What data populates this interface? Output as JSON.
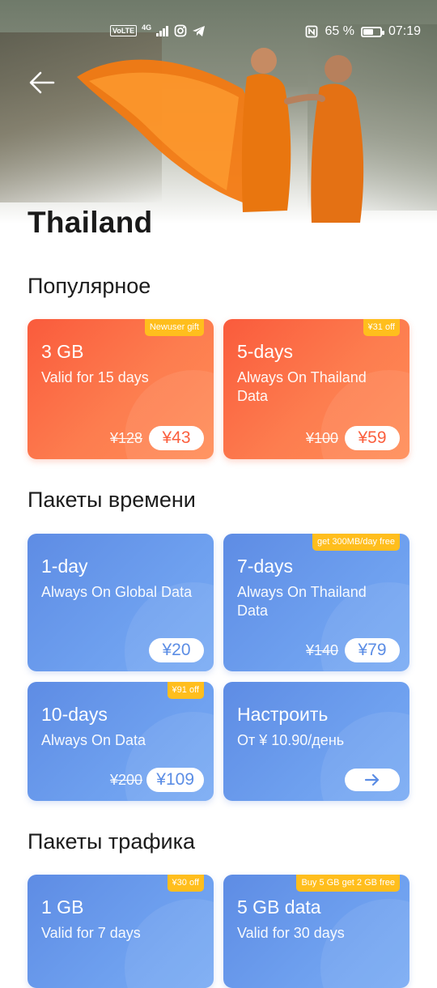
{
  "status_bar": {
    "volte": "VoLTE",
    "network": "4G",
    "battery_percent": "65 %",
    "battery_level": 0.65,
    "time": "07:19"
  },
  "page": {
    "title": "Thailand"
  },
  "sections": {
    "popular": {
      "title": "Популярное",
      "cards": [
        {
          "badge": "Newuser gift",
          "title": "3 GB",
          "subtitle": "Valid for 15 days",
          "old_price": "¥128",
          "price": "¥43",
          "theme": "orange"
        },
        {
          "badge": "¥31 off",
          "title": "5-days",
          "subtitle": "Always On Thailand Data",
          "old_price": "¥100",
          "price": "¥59",
          "theme": "orange"
        }
      ]
    },
    "time_packages": {
      "title": "Пакеты времени",
      "cards": [
        {
          "title": "1-day",
          "subtitle": "Always On Global Data",
          "price": "¥20",
          "theme": "blue"
        },
        {
          "badge": "get 300MB/day free",
          "title": "7-days",
          "subtitle": "Always On Thailand Data",
          "old_price": "¥140",
          "price": "¥79",
          "theme": "blue"
        },
        {
          "badge": "¥91 off",
          "title": "10-days",
          "subtitle": "Always On Data",
          "old_price": "¥200",
          "price": "¥109",
          "theme": "blue"
        },
        {
          "title": "Настроить",
          "subtitle": "От ¥ 10.90/день",
          "theme": "blue"
        }
      ]
    },
    "traffic_packages": {
      "title": "Пакеты трафика",
      "cards": [
        {
          "badge": "¥30 off",
          "title": "1 GB",
          "subtitle": "Valid for 7 days",
          "theme": "blue"
        },
        {
          "badge": "Buy 5 GB get 2 GB free",
          "title": "5 GB data",
          "subtitle": "Valid for 30 days",
          "theme": "blue"
        }
      ]
    }
  },
  "colors": {
    "orange_accent": "#fb5f3e",
    "blue_accent": "#5b8de5",
    "badge_yellow": "#ffbe1d"
  },
  "icons": [
    "back-arrow-icon",
    "nfc-icon",
    "instagram-icon",
    "telegram-icon",
    "signal-icon",
    "battery-icon",
    "arrow-right-icon"
  ]
}
